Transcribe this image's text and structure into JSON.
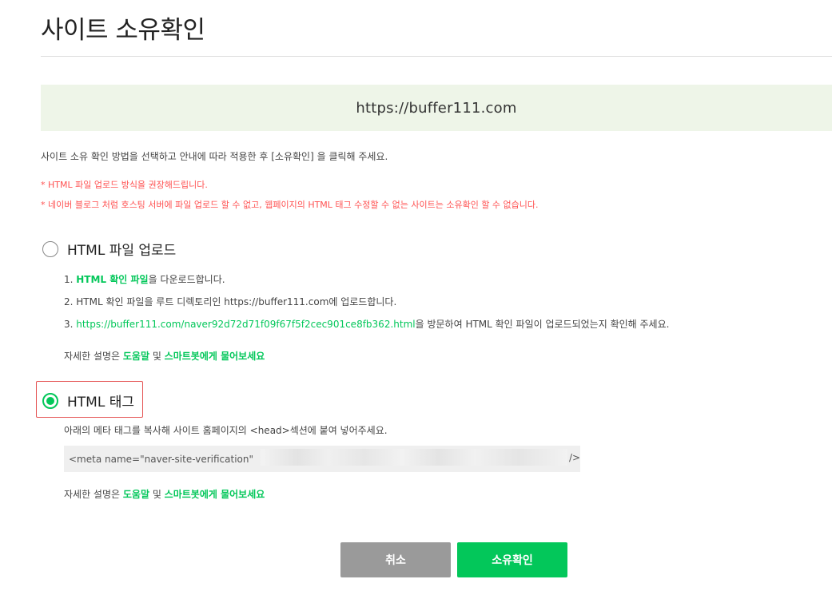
{
  "page": {
    "title": "사이트 소유확인",
    "site_url": "https://buffer111.com",
    "instruction": "사이트 소유 확인 방법을 선택하고 안내에 따라 적용한 후 [소유확인] 을 클릭해 주세요.",
    "notices": [
      "* HTML 파일 업로드 방식을 권장해드립니다.",
      "* 네이버 블로그 처럼 호스팅 서버에 파일 업로드 할 수 없고, 웹페이지의 HTML 태그 수정할 수 없는 사이트는 소유확인 할 수 없습니다."
    ]
  },
  "option_file": {
    "label": "HTML 파일 업로드",
    "selected": false,
    "steps": {
      "s1_prefix": "1. ",
      "s1_link": "HTML 확인 파일",
      "s1_suffix": "을 다운로드합니다.",
      "s2": "2. HTML 확인 파일을 루트 디렉토리인 https://buffer111.com에 업로드합니다.",
      "s3_prefix": "3. ",
      "s3_link": "https://buffer111.com/naver92d72d71f09f67f5f2cec901ce8fb362.html",
      "s3_suffix": "을 방문하여 HTML 확인 파일이 업로드되었는지 확인해 주세요."
    },
    "help": {
      "prefix": "자세한 설명은 ",
      "link1": "도움말",
      "middle": " 및 ",
      "link2": "스마트봇에게 물어보세요"
    }
  },
  "option_tag": {
    "label": "HTML 태그",
    "selected": true,
    "description": "아래의 메타 태그를 복사해 사이트 홈페이지의 <head>섹션에 붙여 넣어주세요.",
    "meta_prefix": "<meta name=\"naver-site-verification\"",
    "meta_suffix": "/>",
    "help": {
      "prefix": "자세한 설명은 ",
      "link1": "도움말",
      "middle": " 및 ",
      "link2": "스마트봇에게 물어보세요"
    }
  },
  "buttons": {
    "cancel": "취소",
    "confirm": "소유확인"
  },
  "colors": {
    "accent": "#03c75a",
    "notice": "#ff5252",
    "banner_bg": "#eef5e8",
    "cancel_bg": "#9a9a9a",
    "highlight_border": "#e55353"
  }
}
